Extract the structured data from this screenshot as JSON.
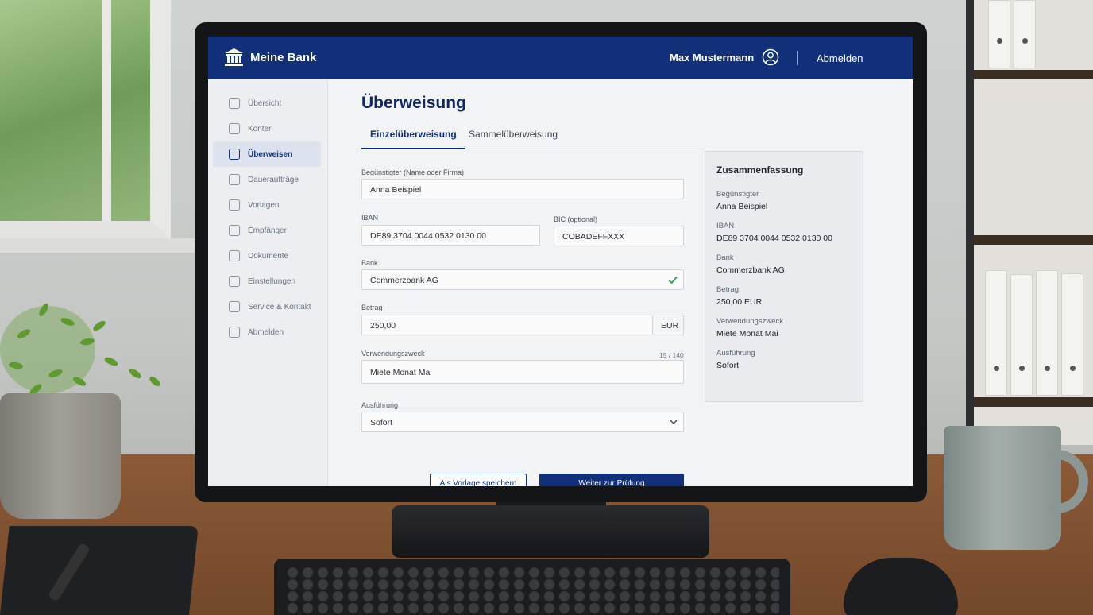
{
  "header": {
    "brand": "Meine Bank",
    "user_name": "Max Mustermann",
    "logout_label": "Abmelden"
  },
  "sidebar": {
    "items": [
      {
        "label": "Übersicht",
        "icon": "home-icon"
      },
      {
        "label": "Konten",
        "icon": "wallet-icon"
      },
      {
        "label": "Überweisen",
        "icon": "transfer-icon",
        "active": true
      },
      {
        "label": "Daueraufträge",
        "icon": "calendar-icon"
      },
      {
        "label": "Vorlagen",
        "icon": "template-icon"
      },
      {
        "label": "Empfänger",
        "icon": "person-icon"
      },
      {
        "label": "Dokumente",
        "icon": "document-icon"
      },
      {
        "label": "Einstellungen",
        "icon": "gear-icon"
      },
      {
        "label": "Service & Kontakt",
        "icon": "help-icon"
      },
      {
        "label": "Abmelden",
        "icon": "logout-icon"
      }
    ]
  },
  "main": {
    "title": "Überweisung",
    "tabs": [
      {
        "label": "Einzelüberweisung",
        "active": true
      },
      {
        "label": "Sammelüberweisung",
        "active": false
      }
    ],
    "form": {
      "beneficiary_label": "Begünstigter (Name oder Firma)",
      "beneficiary_value": "Anna Beispiel",
      "iban_label": "IBAN",
      "iban_value": "DE89 3704 0044 0532 0130 00",
      "bic_label": "BIC (optional)",
      "bic_value": "COBADEFFXXX",
      "bank_label": "Bank",
      "bank_value": "Commerzbank AG",
      "amount_label": "Betrag",
      "amount_value": "250,00",
      "currency": "EUR",
      "purpose_label": "Verwendungszweck",
      "purpose_counter": "15 / 140",
      "purpose_value": "Miete Monat Mai",
      "execution_label": "Ausführung",
      "execution_value": "Sofort"
    },
    "buttons": {
      "save_template": "Als Vorlage speichern",
      "continue": "Weiter zur Prüfung"
    }
  },
  "summary": {
    "title": "Zusammenfassung",
    "rows": [
      {
        "label": "Begünstigter",
        "value": "Anna Beispiel"
      },
      {
        "label": "IBAN",
        "value": "DE89 3704 0044 0532 0130 00"
      },
      {
        "label": "Bank",
        "value": "Commerzbank AG"
      },
      {
        "label": "Betrag",
        "value": "250,00 EUR"
      },
      {
        "label": "Verwendungszweck",
        "value": "Miete Monat Mai"
      },
      {
        "label": "Ausführung",
        "value": "Sofort"
      }
    ]
  },
  "colors": {
    "brand_navy": "#12307a",
    "success_green": "#2e9e5b"
  }
}
